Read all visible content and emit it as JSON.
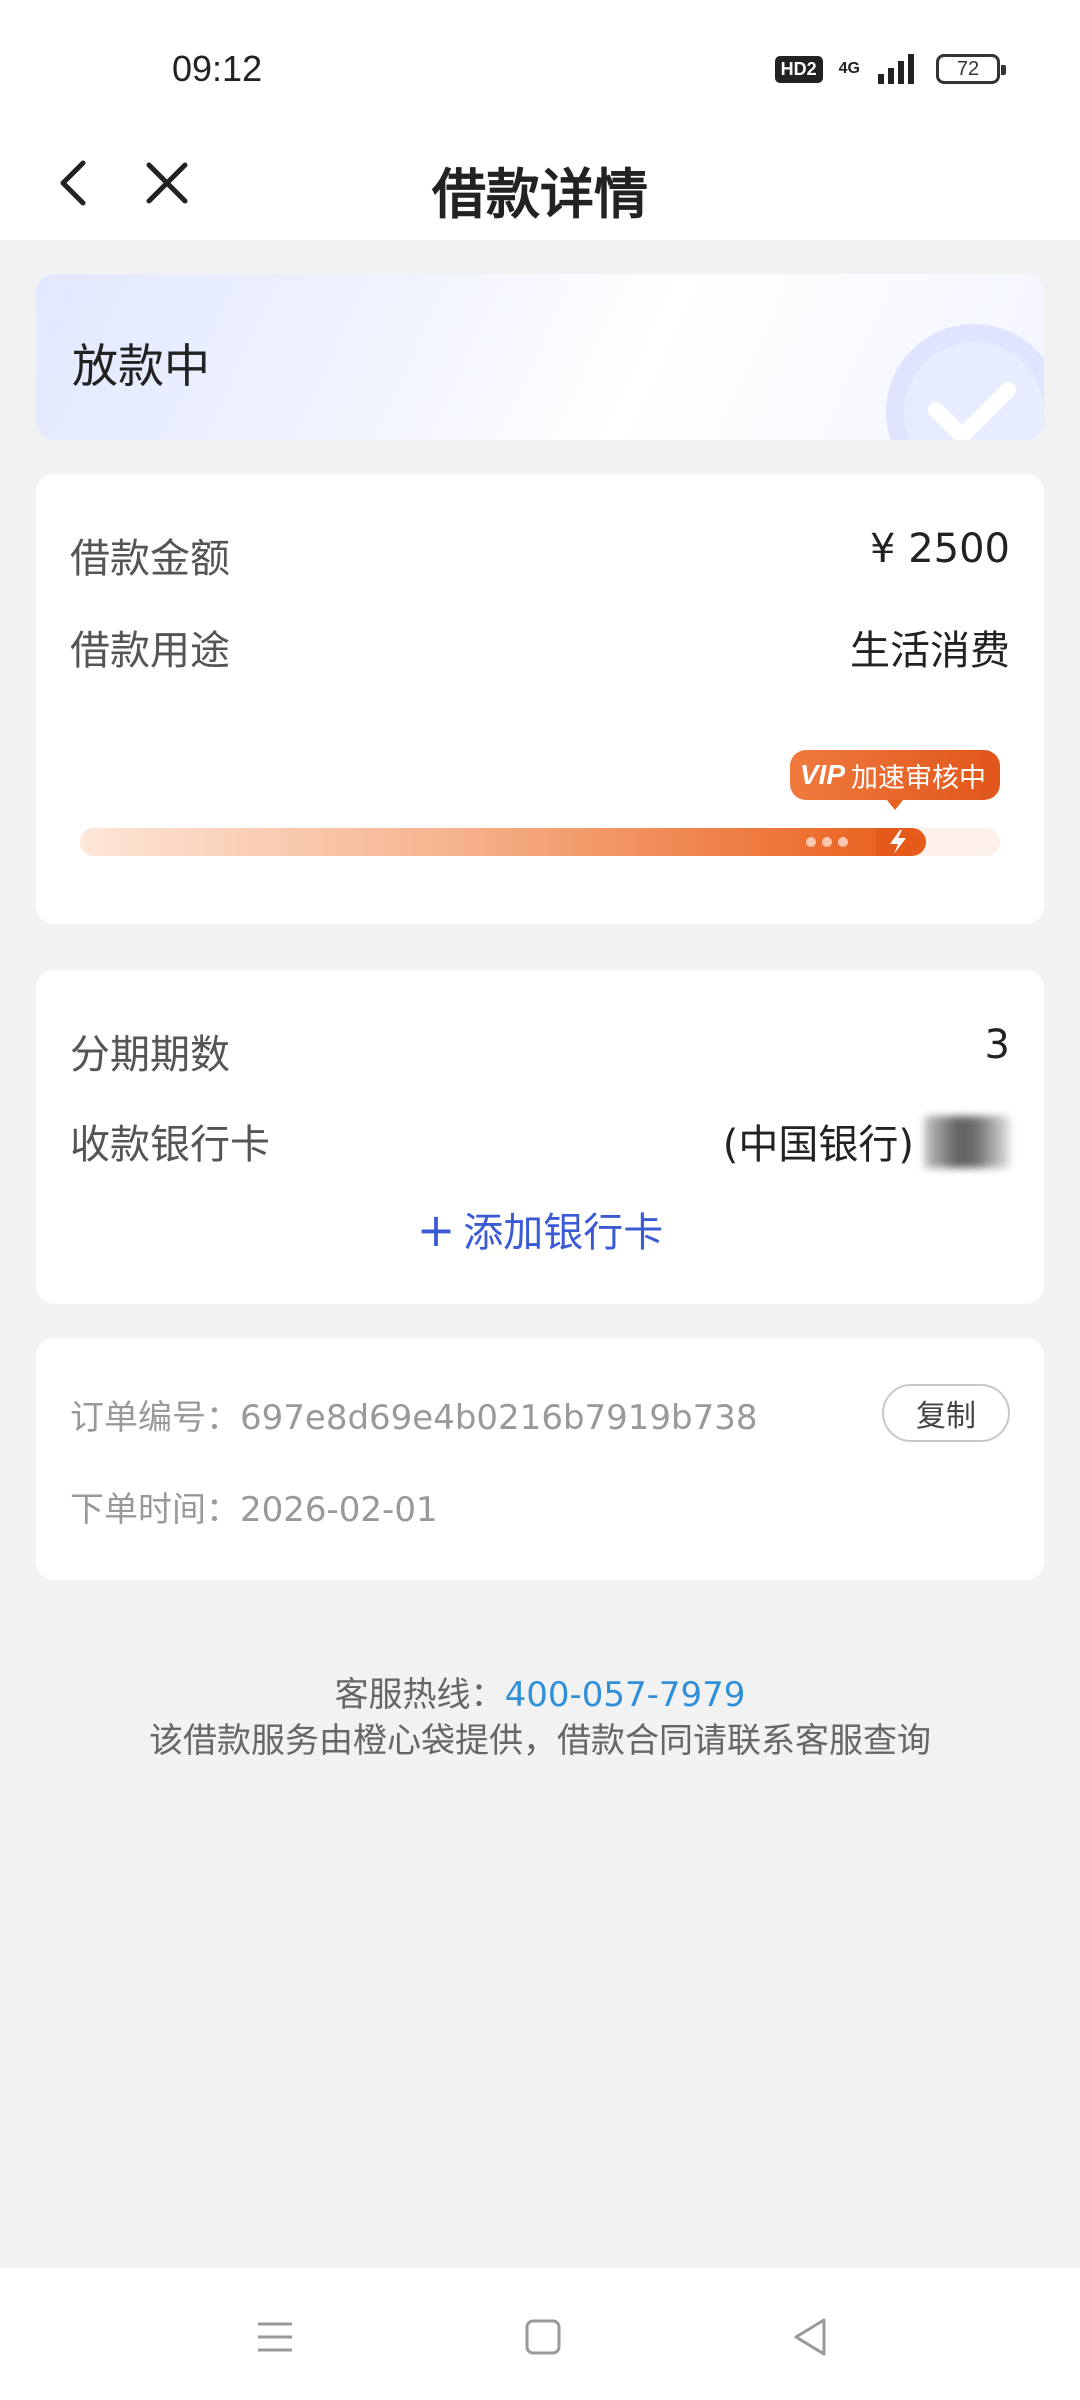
{
  "status_bar": {
    "time": "09:12",
    "hd_badge": "HD2",
    "network": "4G",
    "battery": "72"
  },
  "nav": {
    "title": "借款详情",
    "back_icon": "chevron-left-icon",
    "close_icon": "close-icon"
  },
  "status": {
    "text": "放款中",
    "icon": "check-icon"
  },
  "loan": {
    "amount_label": "借款金额",
    "amount_value": "¥ 2500",
    "purpose_label": "借款用途",
    "purpose_value": "生活消费",
    "vip_tag": "VIP",
    "vip_text": "加速审核中",
    "progress": 0.92
  },
  "installment": {
    "periods_label": "分期期数",
    "periods_value": "3",
    "bank_label": "收款银行卡",
    "bank_value": "(中国银行)",
    "add_card_label": "添加银行卡"
  },
  "order": {
    "number_label": "订单编号：",
    "number_value": "697e8d69e4b0216b7919b738",
    "copy_label": "复制",
    "time_label": "下单时间：",
    "time_value": "2026-02-01"
  },
  "footer": {
    "hotline_label": "客服热线：",
    "hotline_number": "400-057-7979",
    "disclaimer": "该借款服务由橙心袋提供，借款合同请联系客服查询"
  },
  "colors": {
    "accent": "#3a5ad6",
    "orange": "#e55a18",
    "link": "#2f8fd8"
  }
}
